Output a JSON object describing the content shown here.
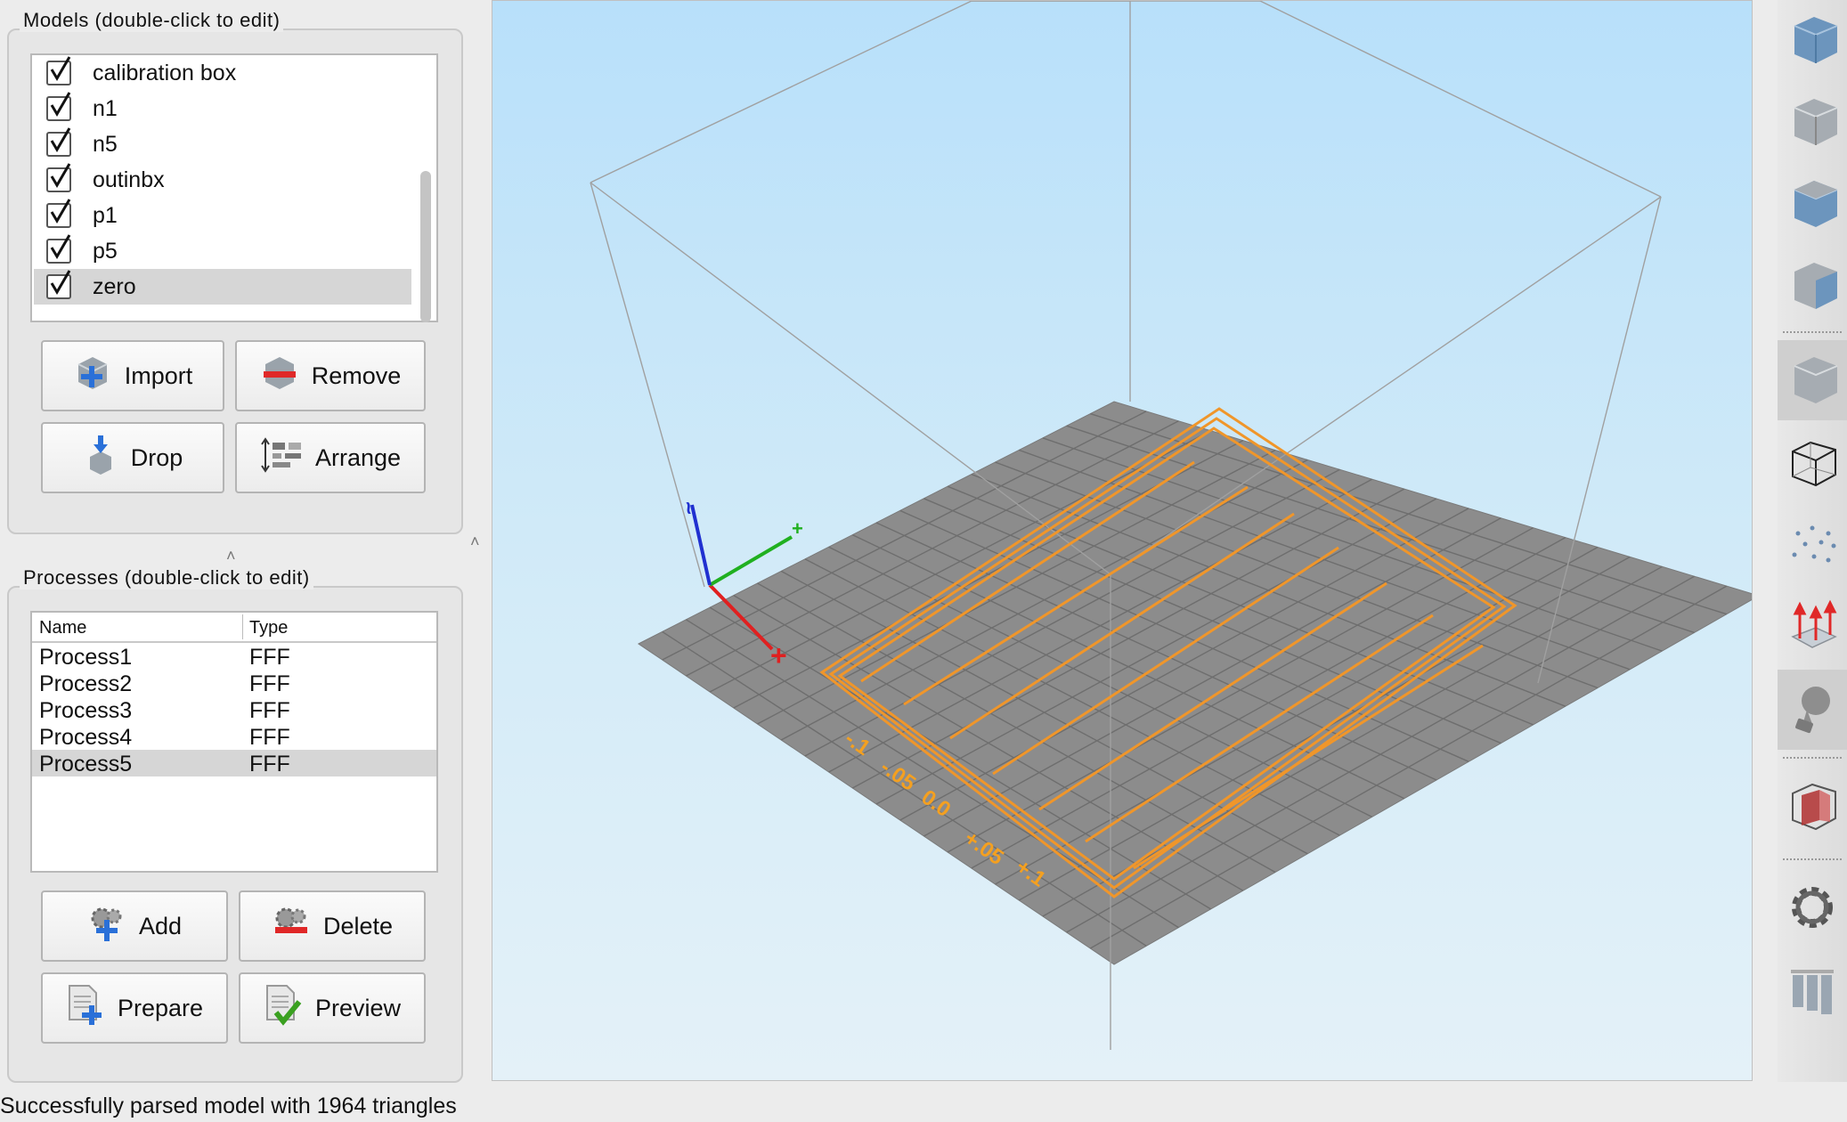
{
  "models": {
    "title": "Models (double-click to edit)",
    "items": [
      {
        "label": "calibration box",
        "checked": true
      },
      {
        "label": "n1",
        "checked": true
      },
      {
        "label": "n5",
        "checked": true
      },
      {
        "label": "outinbx",
        "checked": true
      },
      {
        "label": "p1",
        "checked": true
      },
      {
        "label": "p5",
        "checked": true
      },
      {
        "label": "zero",
        "checked": true,
        "selected": true
      }
    ],
    "buttons": {
      "import": "Import",
      "remove": "Remove",
      "drop": "Drop",
      "arrange": "Arrange"
    }
  },
  "processes": {
    "title": "Processes (double-click to edit)",
    "columns": {
      "name": "Name",
      "type": "Type"
    },
    "rows": [
      {
        "name": "Process1",
        "type": "FFF"
      },
      {
        "name": "Process2",
        "type": "FFF"
      },
      {
        "name": "Process3",
        "type": "FFF"
      },
      {
        "name": "Process4",
        "type": "FFF"
      },
      {
        "name": "Process5",
        "type": "FFF",
        "selected": true
      }
    ],
    "buttons": {
      "add": "Add",
      "delete": "Delete",
      "prepare": "Prepare",
      "preview": "Preview"
    }
  },
  "viewport": {
    "bed_labels": [
      "-.1",
      "-.05",
      "0.0",
      "+.05",
      "+.1"
    ],
    "colors": {
      "toolpath": "#f0962a",
      "bed": "#8c8c8c",
      "x_axis": "#e02020",
      "y_axis": "#20b020",
      "z_axis": "#2030d0"
    }
  },
  "toolbar": {
    "tools": [
      "view-iso-icon",
      "view-front-icon",
      "view-top-icon",
      "view-side-icon",
      "solid-render-icon",
      "wireframe-icon",
      "point-cloud-icon",
      "normals-icon",
      "lighting-icon",
      "cross-section-icon",
      "settings-gear-icon",
      "columns-icon"
    ]
  },
  "status": {
    "text": "Successfully parsed model with 1964 triangles"
  }
}
